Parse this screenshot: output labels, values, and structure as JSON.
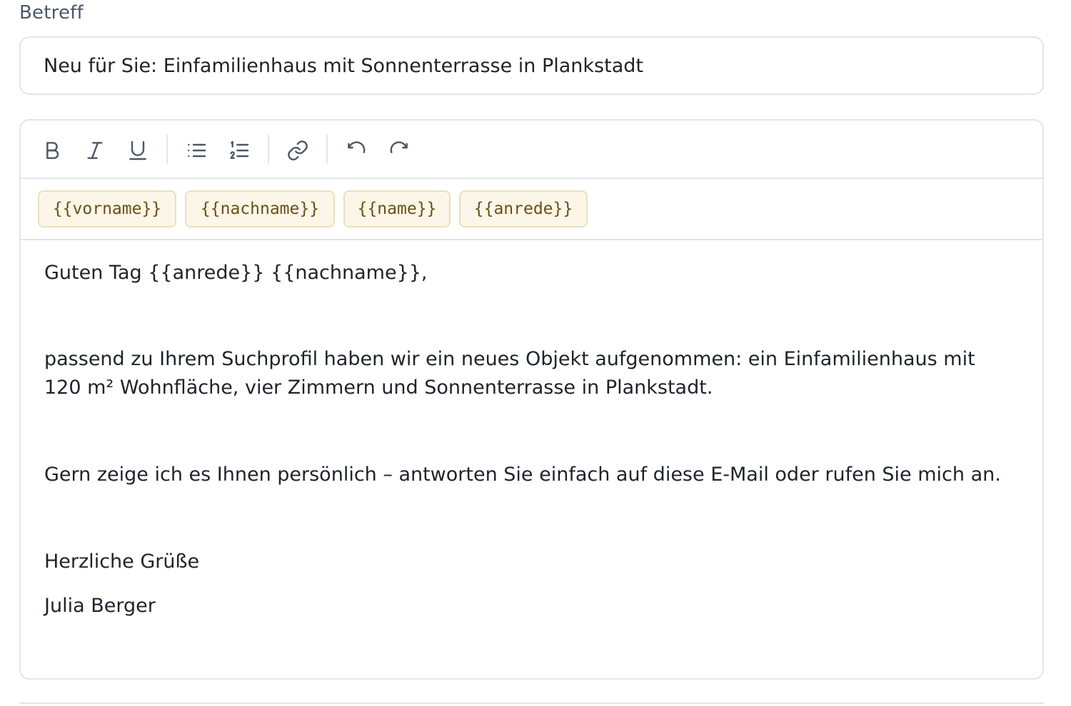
{
  "subject": {
    "label": "Betreff",
    "value": "Neu für Sie: Einfamilienhaus mit Sonnenterrasse in Plankstadt"
  },
  "toolbar": {
    "buttons": [
      {
        "name": "bold",
        "icon": "bold-icon"
      },
      {
        "name": "italic",
        "icon": "italic-icon"
      },
      {
        "name": "underline",
        "icon": "underline-icon"
      },
      {
        "name": "bullet-list",
        "icon": "bullet-list-icon"
      },
      {
        "name": "numbered-list",
        "icon": "numbered-list-icon"
      },
      {
        "name": "link",
        "icon": "link-icon"
      },
      {
        "name": "undo",
        "icon": "undo-icon"
      },
      {
        "name": "redo",
        "icon": "redo-icon"
      }
    ]
  },
  "placeholders": [
    "{{vorname}}",
    "{{nachname}}",
    "{{name}}",
    "{{anrede}}"
  ],
  "body": {
    "greeting": "Guten Tag {{anrede}} {{nachname}},",
    "para1_line1": "passend zu Ihrem Suchprofil haben wir ein neues Objekt aufgenommen: ein Einfamilienhaus mit",
    "para1_line2": "120 m² Wohnfläche, vier Zimmern und Sonnenterrasse in Plankstadt.",
    "para2": "Gern zeige ich es Ihnen persönlich – antworten Sie einfach auf diese E-Mail oder rufen Sie mich an.",
    "closing": "Herzliche Grüße",
    "signature": "Julia Berger"
  },
  "colors": {
    "border": "#e3e5e8",
    "chip_bg": "#fbf6e8",
    "chip_border": "#ecdfbc",
    "chip_text": "#6b4f17",
    "icon": "#4a5868"
  }
}
